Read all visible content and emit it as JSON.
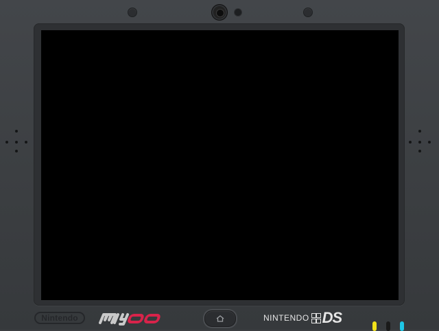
{
  "device": {
    "brand_left": "Nintendo",
    "brand_center": "miyoo",
    "brand_right_word": "NINTENDO",
    "brand_right_ds": "DS"
  },
  "icons": {
    "home": "home-icon",
    "camera": "camera-icon"
  },
  "colors": {
    "body": "#3c3f42",
    "screen": "#000000",
    "miyoo_logo": "#d8234a",
    "led_yellow": "#f2e21a",
    "led_off": "#1a1a1a",
    "led_cyan": "#1ec6e6"
  }
}
